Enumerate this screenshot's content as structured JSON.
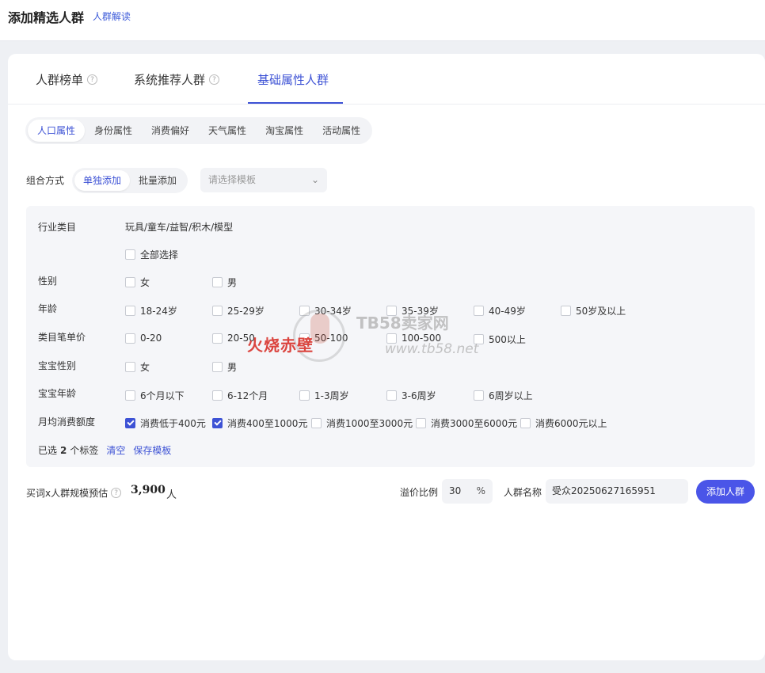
{
  "header": {
    "title": "添加精选人群",
    "link": "人群解读"
  },
  "tabs": [
    {
      "label": "人群榜单",
      "has_help": true
    },
    {
      "label": "系统推荐人群",
      "has_help": true
    },
    {
      "label": "基础属性人群",
      "active": true
    }
  ],
  "subtabs": [
    "人口属性",
    "身份属性",
    "消费偏好",
    "天气属性",
    "淘宝属性",
    "活动属性"
  ],
  "combo": {
    "label": "组合方式",
    "options": [
      "单独添加",
      "批量添加"
    ],
    "template_placeholder": "请选择模板"
  },
  "filters": {
    "industry": {
      "label": "行业类目",
      "value": "玩具/童车/益智/积木/模型"
    },
    "select_all": "全部选择",
    "gender": {
      "label": "性别",
      "options": [
        "女",
        "男"
      ]
    },
    "age": {
      "label": "年龄",
      "options": [
        "18-24岁",
        "25-29岁",
        "30-34岁",
        "35-39岁",
        "40-49岁",
        "50岁及以上"
      ]
    },
    "price": {
      "label": "类目笔单价",
      "options": [
        "0-20",
        "20-50",
        "50-100",
        "100-500",
        "500以上"
      ]
    },
    "baby_gender": {
      "label": "宝宝性别",
      "options": [
        "女",
        "男"
      ]
    },
    "baby_age": {
      "label": "宝宝年龄",
      "options": [
        "6个月以下",
        "6-12个月",
        "1-3周岁",
        "3-6周岁",
        "6周岁以上"
      ]
    },
    "spend": {
      "label": "月均消费额度",
      "options": [
        "消费低于400元",
        "消费400至1000元",
        "消费1000至3000元",
        "消费3000至6000元",
        "消费6000元以上"
      ],
      "checked": [
        true,
        true,
        false,
        false,
        false
      ]
    }
  },
  "summary": {
    "prefix": "已选",
    "count": "2",
    "suffix": "个标签",
    "clear": "清空",
    "save": "保存模板"
  },
  "bottom": {
    "estimate_label": "买词x人群规模预估",
    "estimate_value": "3,900",
    "estimate_unit": "人",
    "premium_label": "溢价比例",
    "premium_value": "30",
    "premium_unit": "%",
    "name_label": "人群名称",
    "name_value": "受众20250627165951",
    "add_button": "添加人群"
  },
  "watermark": {
    "brand": "火烧赤壁",
    "site": "TB58卖家网",
    "url": "www.tb58.net"
  },
  "colors": {
    "accent": "#3d52d5",
    "button": "#4a55e8",
    "panel": "#f5f6f9"
  }
}
